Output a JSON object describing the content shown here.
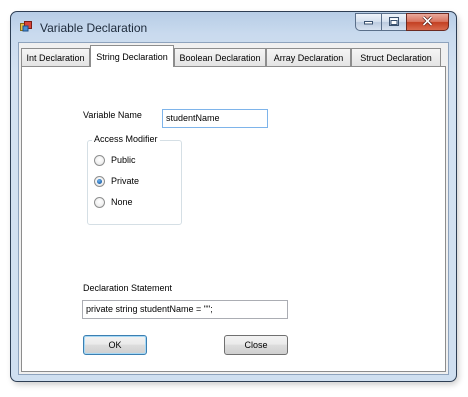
{
  "window": {
    "title": "Variable Declaration",
    "accent_color": "#c9daee"
  },
  "tabs": [
    {
      "label": "Int Declaration",
      "active": false
    },
    {
      "label": "String Declaration",
      "active": true
    },
    {
      "label": "Boolean Declaration",
      "active": false
    },
    {
      "label": "Array Declaration",
      "active": false
    },
    {
      "label": "Struct Declaration",
      "active": false
    }
  ],
  "form": {
    "variable_name_label": "Variable Name",
    "variable_name_value": "studentName",
    "access_modifier": {
      "title": "Access Modifier",
      "options": [
        {
          "label": "Public",
          "checked": false
        },
        {
          "label": "Private",
          "checked": true
        },
        {
          "label": "None",
          "checked": false
        }
      ],
      "selected": "Private"
    },
    "declaration_label": "Declaration Statement",
    "declaration_value": "private string studentName = \"\";"
  },
  "buttons": {
    "ok_label": "OK",
    "close_label": "Close"
  },
  "icons": {
    "app": "app-window-icon",
    "minimize": "minimize-icon",
    "maximize": "maximize-icon",
    "close": "close-icon"
  }
}
